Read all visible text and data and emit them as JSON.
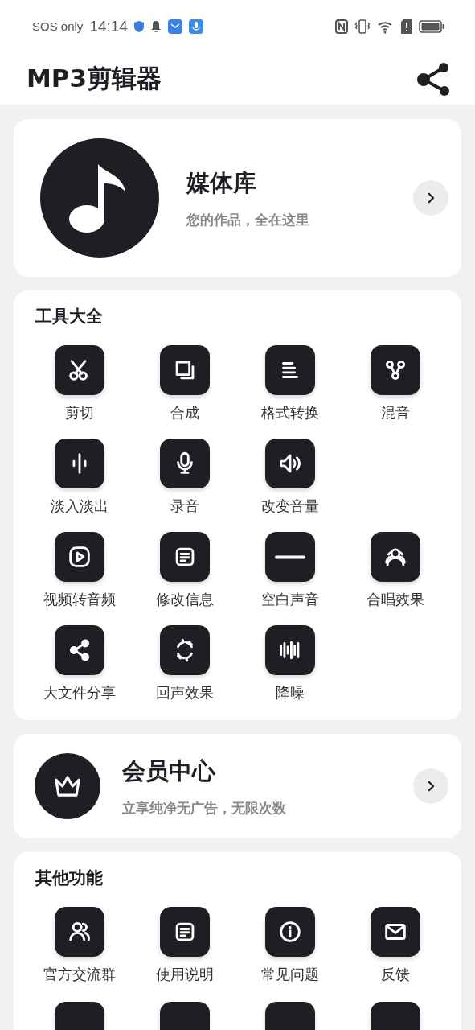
{
  "status_bar": {
    "carrier": "SOS only",
    "time": "14:14"
  },
  "app_bar": {
    "title": "MP3剪辑器"
  },
  "media_card": {
    "title": "媒体库",
    "subtitle": "您的作品，全在这里"
  },
  "tools": {
    "title": "工具大全",
    "rows": [
      [
        "剪切",
        "合成",
        "格式转换",
        "混音"
      ],
      [
        "淡入淡出",
        "录音",
        "改变音量"
      ],
      [
        "视频转音频",
        "修改信息",
        "空白声音",
        "合唱效果"
      ],
      [
        "大文件分享",
        "回声效果",
        "降噪"
      ]
    ]
  },
  "member_card": {
    "title": "会员中心",
    "subtitle": "立享纯净无广告，无限次数"
  },
  "other": {
    "title": "其他功能",
    "rows": [
      [
        "官方交流群",
        "使用说明",
        "常见问题",
        "反馈"
      ]
    ]
  }
}
